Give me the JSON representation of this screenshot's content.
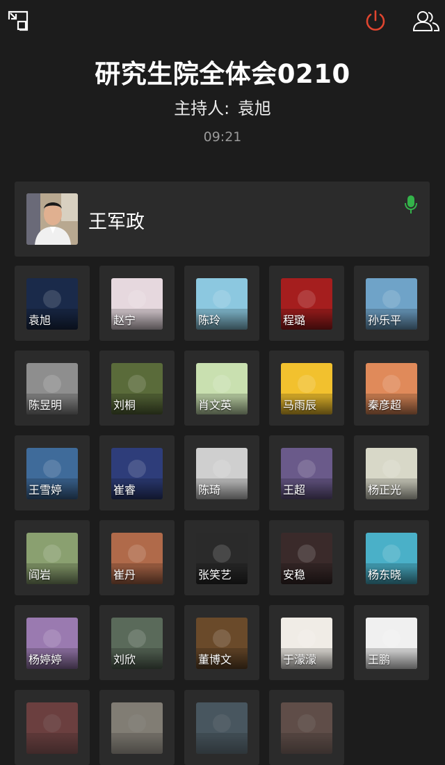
{
  "header": {
    "title": "研究生院全体会0210",
    "host_label": "主持人:",
    "host_name": "袁旭",
    "timer": "09:21"
  },
  "icons": {
    "minimize": "minimize-window-icon",
    "power": "power-icon",
    "members": "members-icon",
    "mic": "microphone-icon"
  },
  "colors": {
    "background": "#1c1c1c",
    "tile": "#2b2b2b",
    "power": "#e0452f",
    "mic": "#34b34a"
  },
  "speaker": {
    "name": "王军政",
    "avatar_desc": "portrait"
  },
  "participants": [
    {
      "name": "袁旭",
      "bg": "#1a2a4a"
    },
    {
      "name": "赵宁",
      "bg": "#e6d8de"
    },
    {
      "name": "陈玲",
      "bg": "#8cc8e0"
    },
    {
      "name": "程璐",
      "bg": "#a51e1e"
    },
    {
      "name": "孙乐平",
      "bg": "#6fa3c8"
    },
    {
      "name": "陈昱明",
      "bg": "#8e8e8e"
    },
    {
      "name": "刘桐",
      "bg": "#5a6b3a"
    },
    {
      "name": "肖文英",
      "bg": "#c9e0b0"
    },
    {
      "name": "马雨辰",
      "bg": "#f2c12e"
    },
    {
      "name": "秦彦超",
      "bg": "#e08a5a"
    },
    {
      "name": "王雪婷",
      "bg": "#3f6b9a"
    },
    {
      "name": "崔睿",
      "bg": "#2e3d7a"
    },
    {
      "name": "陈琦",
      "bg": "#cfcfcf"
    },
    {
      "name": "王超",
      "bg": "#6a5a8a"
    },
    {
      "name": "杨正光",
      "bg": "#d8d8c8"
    },
    {
      "name": "阎岩",
      "bg": "#8aa070"
    },
    {
      "name": "崔丹",
      "bg": "#b06a4a"
    },
    {
      "name": "张笑艺",
      "bg": "#2a2a2a"
    },
    {
      "name": "安稳",
      "bg": "#3a2a2a"
    },
    {
      "name": "杨东晓",
      "bg": "#4ab0c8"
    },
    {
      "name": "杨婷婷",
      "bg": "#9a7ab0"
    },
    {
      "name": "刘欣",
      "bg": "#5a6a5a"
    },
    {
      "name": "董博文",
      "bg": "#6a4a2a"
    },
    {
      "name": "于濛濛",
      "bg": "#f0ece6"
    },
    {
      "name": "王鹏",
      "bg": "#f0f0f0"
    },
    {
      "name": "",
      "bg": "#a05050",
      "faded": true
    },
    {
      "name": "",
      "bg": "#c8c0b0",
      "faded": true
    },
    {
      "name": "",
      "bg": "#607a8a",
      "faded": true
    },
    {
      "name": "",
      "bg": "#8a6a60",
      "faded": true
    }
  ]
}
